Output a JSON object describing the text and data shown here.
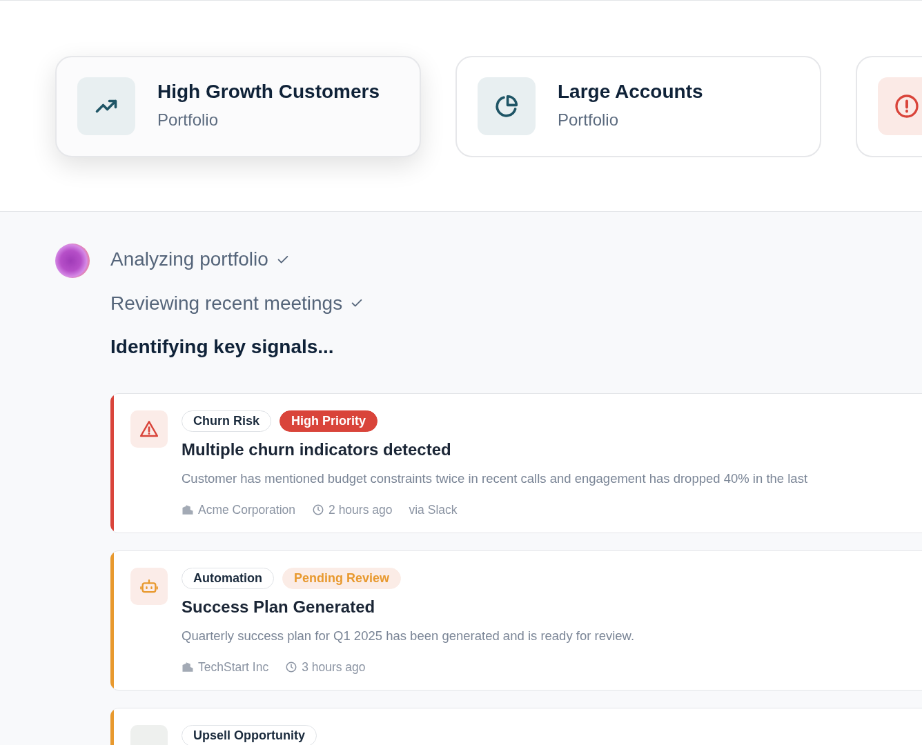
{
  "portfolios": [
    {
      "kind": "trend",
      "title": "High Growth Customers",
      "subtitle": "Portfolio",
      "selected": true
    },
    {
      "kind": "pie",
      "title": "Large Accounts",
      "subtitle": "Portfolio",
      "selected": false
    },
    {
      "kind": "alert",
      "selected": false
    }
  ],
  "steps": [
    {
      "label": "Analyzing portfolio",
      "done": true
    },
    {
      "label": "Reviewing recent meetings",
      "done": true
    },
    {
      "label": "Identifying key signals...",
      "done": false
    }
  ],
  "signals": [
    {
      "kind": "churn",
      "color": "#d9443a",
      "tags": [
        {
          "label": "Churn Risk",
          "kind": "outline"
        },
        {
          "label": "High Priority",
          "kind": "danger"
        }
      ],
      "title": "Multiple churn indicators detected",
      "description": "Customer has mentioned budget constraints twice in recent calls and engagement has dropped 40% in the last",
      "company": "Acme Corporation",
      "time": "2 hours ago",
      "source": "via Slack"
    },
    {
      "kind": "automation",
      "color": "#e8992e",
      "tags": [
        {
          "label": "Automation",
          "kind": "outline"
        },
        {
          "label": "Pending Review",
          "kind": "warning"
        }
      ],
      "title": "Success Plan Generated",
      "description": "Quarterly success plan for Q1 2025 has been generated and is ready for review.",
      "company": "TechStart Inc",
      "time": "3 hours ago"
    },
    {
      "kind": "upsell",
      "color": "#e8992e",
      "tags": [
        {
          "label": "Upsell Opportunity",
          "kind": "outline"
        }
      ]
    }
  ]
}
